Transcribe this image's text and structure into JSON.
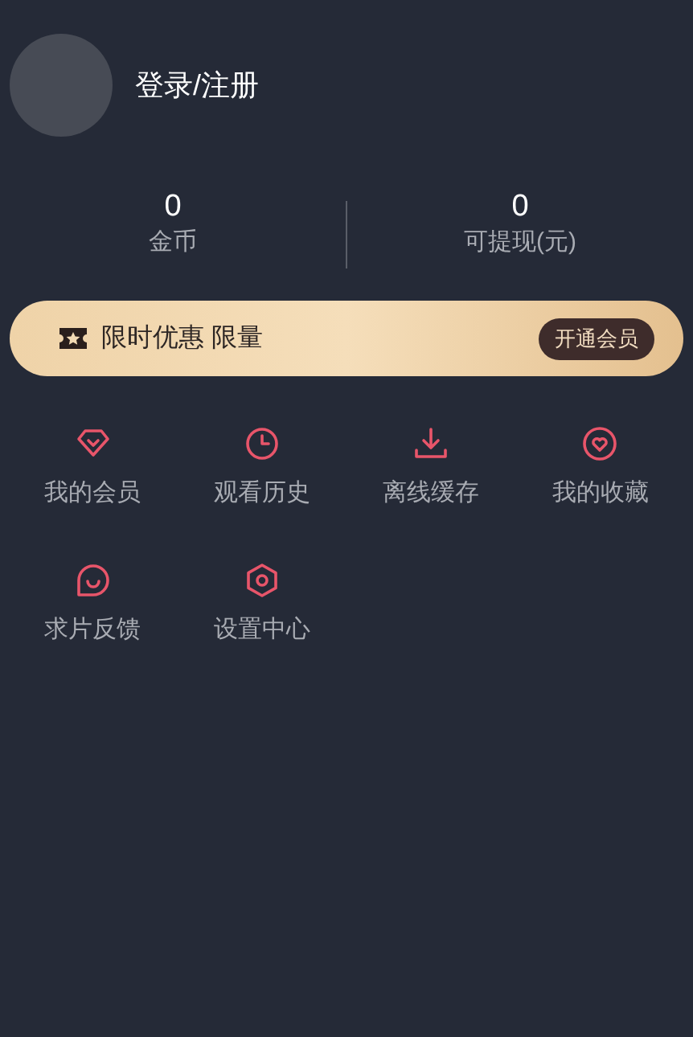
{
  "profile": {
    "login_label": "登录/注册"
  },
  "stats": [
    {
      "value": "0",
      "label": "金币"
    },
    {
      "value": "0",
      "label": "可提现(元)"
    }
  ],
  "promo": {
    "text": "限时优惠 限量",
    "button": "开通会员"
  },
  "menu": [
    {
      "kind": "diamond",
      "label": "我的会员"
    },
    {
      "kind": "clock",
      "label": "观看历史"
    },
    {
      "kind": "download",
      "label": "离线缓存"
    },
    {
      "kind": "heart",
      "label": "我的收藏"
    },
    {
      "kind": "chat",
      "label": "求片反馈"
    },
    {
      "kind": "gear",
      "label": "设置中心"
    }
  ]
}
